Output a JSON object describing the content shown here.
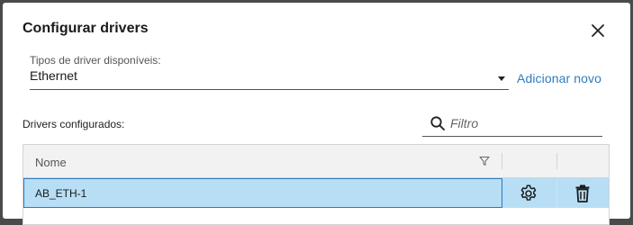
{
  "dialog": {
    "title": "Configurar drivers",
    "close_icon": "close-icon"
  },
  "driver_type": {
    "label": "Tipos de driver disponíveis:",
    "value": "Ethernet",
    "icon": "caret-down-icon"
  },
  "add_new": {
    "label": "Adicionar novo"
  },
  "configured": {
    "label": "Drivers configurados:"
  },
  "search": {
    "placeholder": "Filtro",
    "value": "",
    "icon": "search-icon"
  },
  "grid": {
    "columns": [
      {
        "label": "Nome",
        "icon": "filter-icon"
      },
      {
        "label": "",
        "icon": "settings-column"
      },
      {
        "label": "",
        "icon": "delete-column"
      }
    ],
    "rows": [
      {
        "name": "AB_ETH-1",
        "selected": true,
        "actions": [
          "gear-icon",
          "trash-icon"
        ]
      }
    ]
  },
  "colors": {
    "accent": "#2e7bbf",
    "selected_row": "#b7def5",
    "header_bg": "#f2f2f2",
    "backdrop": "#4a4a4a"
  }
}
